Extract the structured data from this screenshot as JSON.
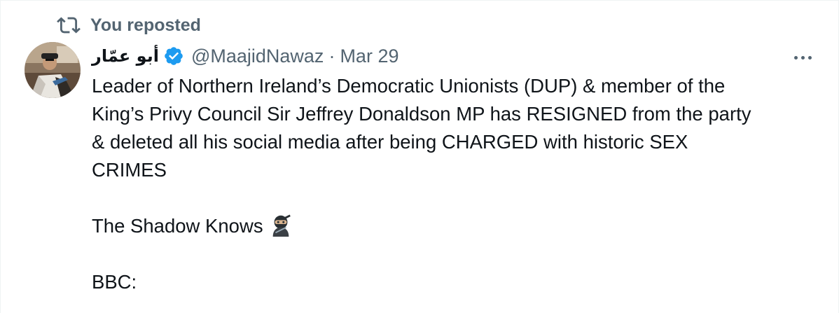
{
  "repost": {
    "label": "You reposted",
    "icon": "repost-icon"
  },
  "tweet": {
    "author_name": "أبو عمّار",
    "verified": true,
    "handle": "@MaajidNawaz",
    "separator": "·",
    "date": "Mar 29",
    "more_icon": "more-horizontal-icon",
    "lines": [
      "Leader of Northern Ireland’s Democratic Unionists (DUP) & member of the",
      "King’s Privy Council Sir Jeffrey Donaldson MP has RESIGNED from the party",
      "& deleted all his social media after being CHARGED with historic SEX",
      "CRIMES"
    ],
    "shadow_line": "The Shadow Knows",
    "emoji": "ninja-emoji",
    "source_line": "BBC:"
  },
  "colors": {
    "muted": "#536471",
    "text": "#0f1419",
    "verified_blue": "#1d9bf0"
  }
}
